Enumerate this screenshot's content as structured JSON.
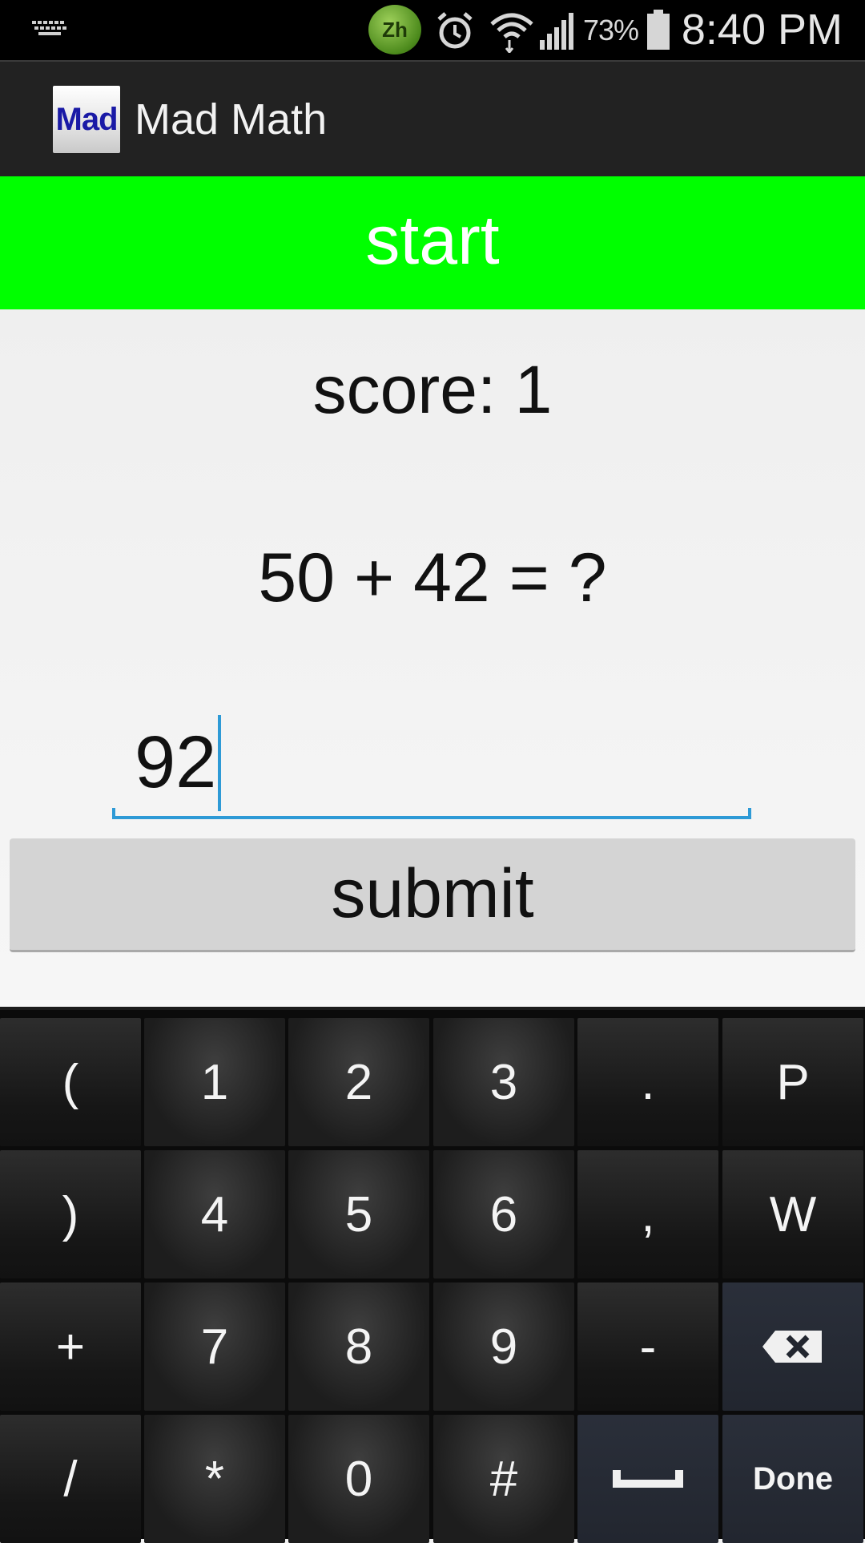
{
  "status_bar": {
    "ime_badge": "Zh",
    "battery_percent": "73%",
    "time": "8:40 PM",
    "icons": [
      "keyboard-icon",
      "ime-zh-icon",
      "alarm-icon",
      "wifi-icon",
      "signal-icon",
      "battery-icon"
    ]
  },
  "action_bar": {
    "app_icon_text": "Mad",
    "title": "Mad Math"
  },
  "game": {
    "start_label": "start",
    "score": "score: 1",
    "question": "50 + 42 = ?",
    "answer_value": "92",
    "submit_label": "submit"
  },
  "keyboard": {
    "rows": [
      [
        "(",
        "1",
        "2",
        "3",
        ".",
        "P"
      ],
      [
        ")",
        "4",
        "5",
        "6",
        ",",
        "W"
      ],
      [
        "+",
        "7",
        "8",
        "9",
        "-",
        "backspace"
      ],
      [
        "/",
        "*",
        "0",
        "#",
        "space",
        "Done"
      ]
    ]
  },
  "colors": {
    "start_bg": "#00ff00",
    "accent": "#2e9ad6",
    "action_bar_bg": "#222222"
  }
}
